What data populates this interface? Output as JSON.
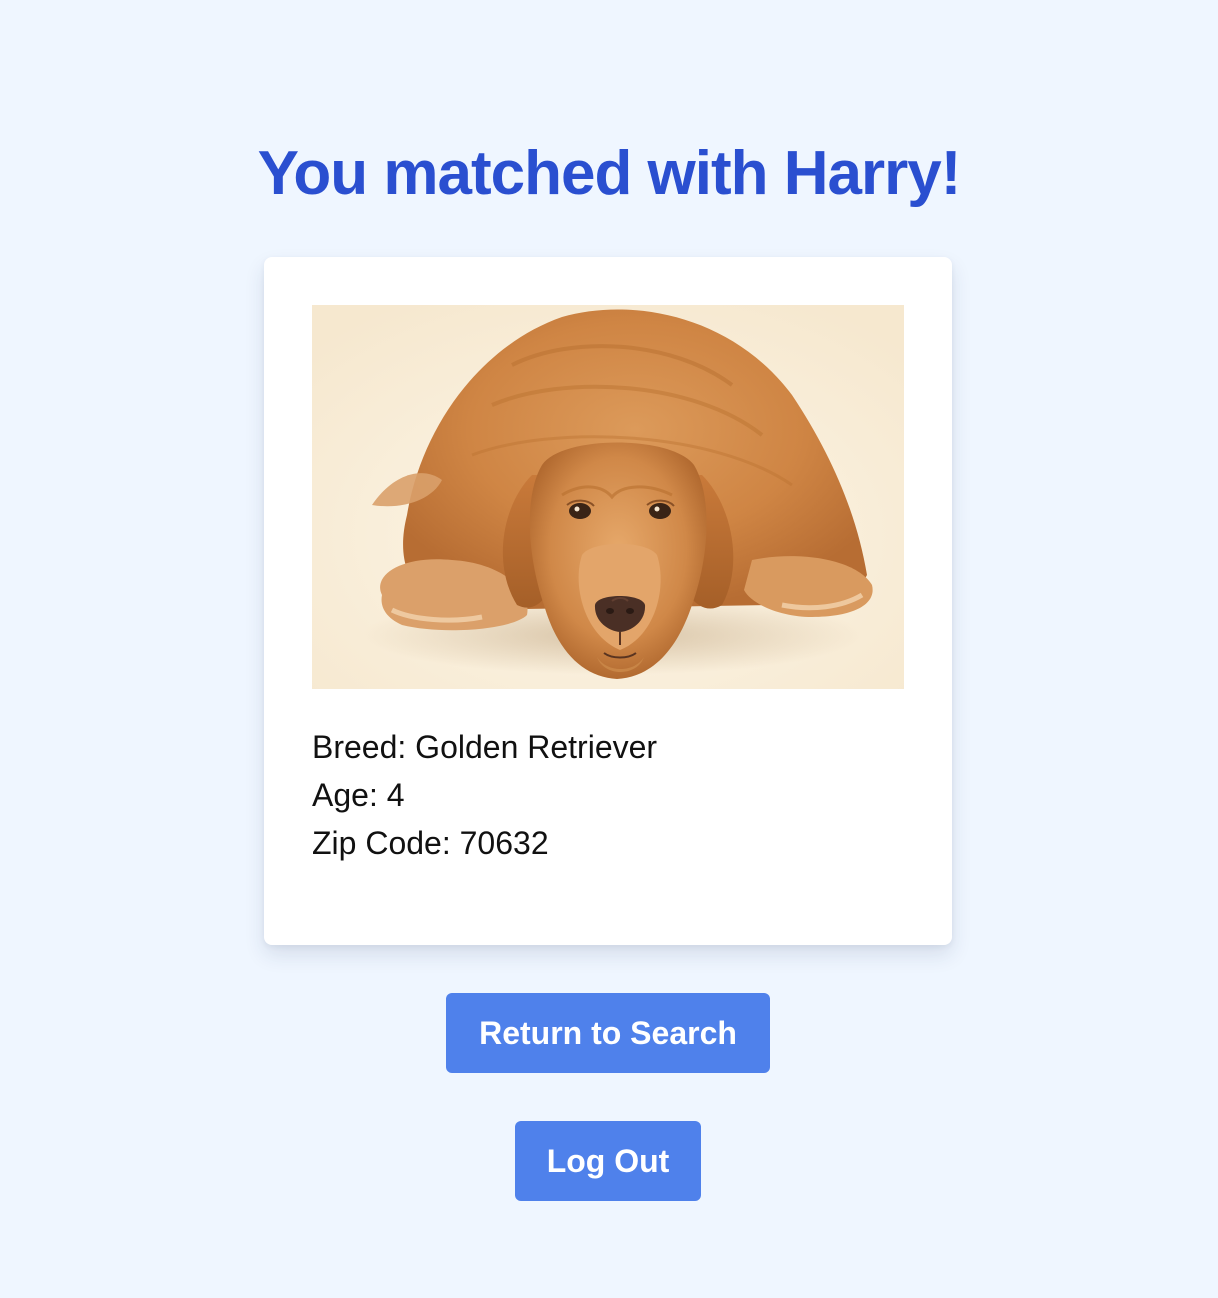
{
  "header": {
    "title": "You matched with Harry!"
  },
  "match_card": {
    "photo_icon": "golden-retriever-photo",
    "breed_line": "Breed: Golden Retriever",
    "age_line": "Age: 4",
    "zip_line": "Zip Code: 70632"
  },
  "actions": {
    "return_label": "Return to Search",
    "logout_label": "Log Out"
  },
  "colors": {
    "background": "#eff6ff",
    "title": "#2a4fd0",
    "button": "#4f81eb",
    "card": "#ffffff"
  }
}
